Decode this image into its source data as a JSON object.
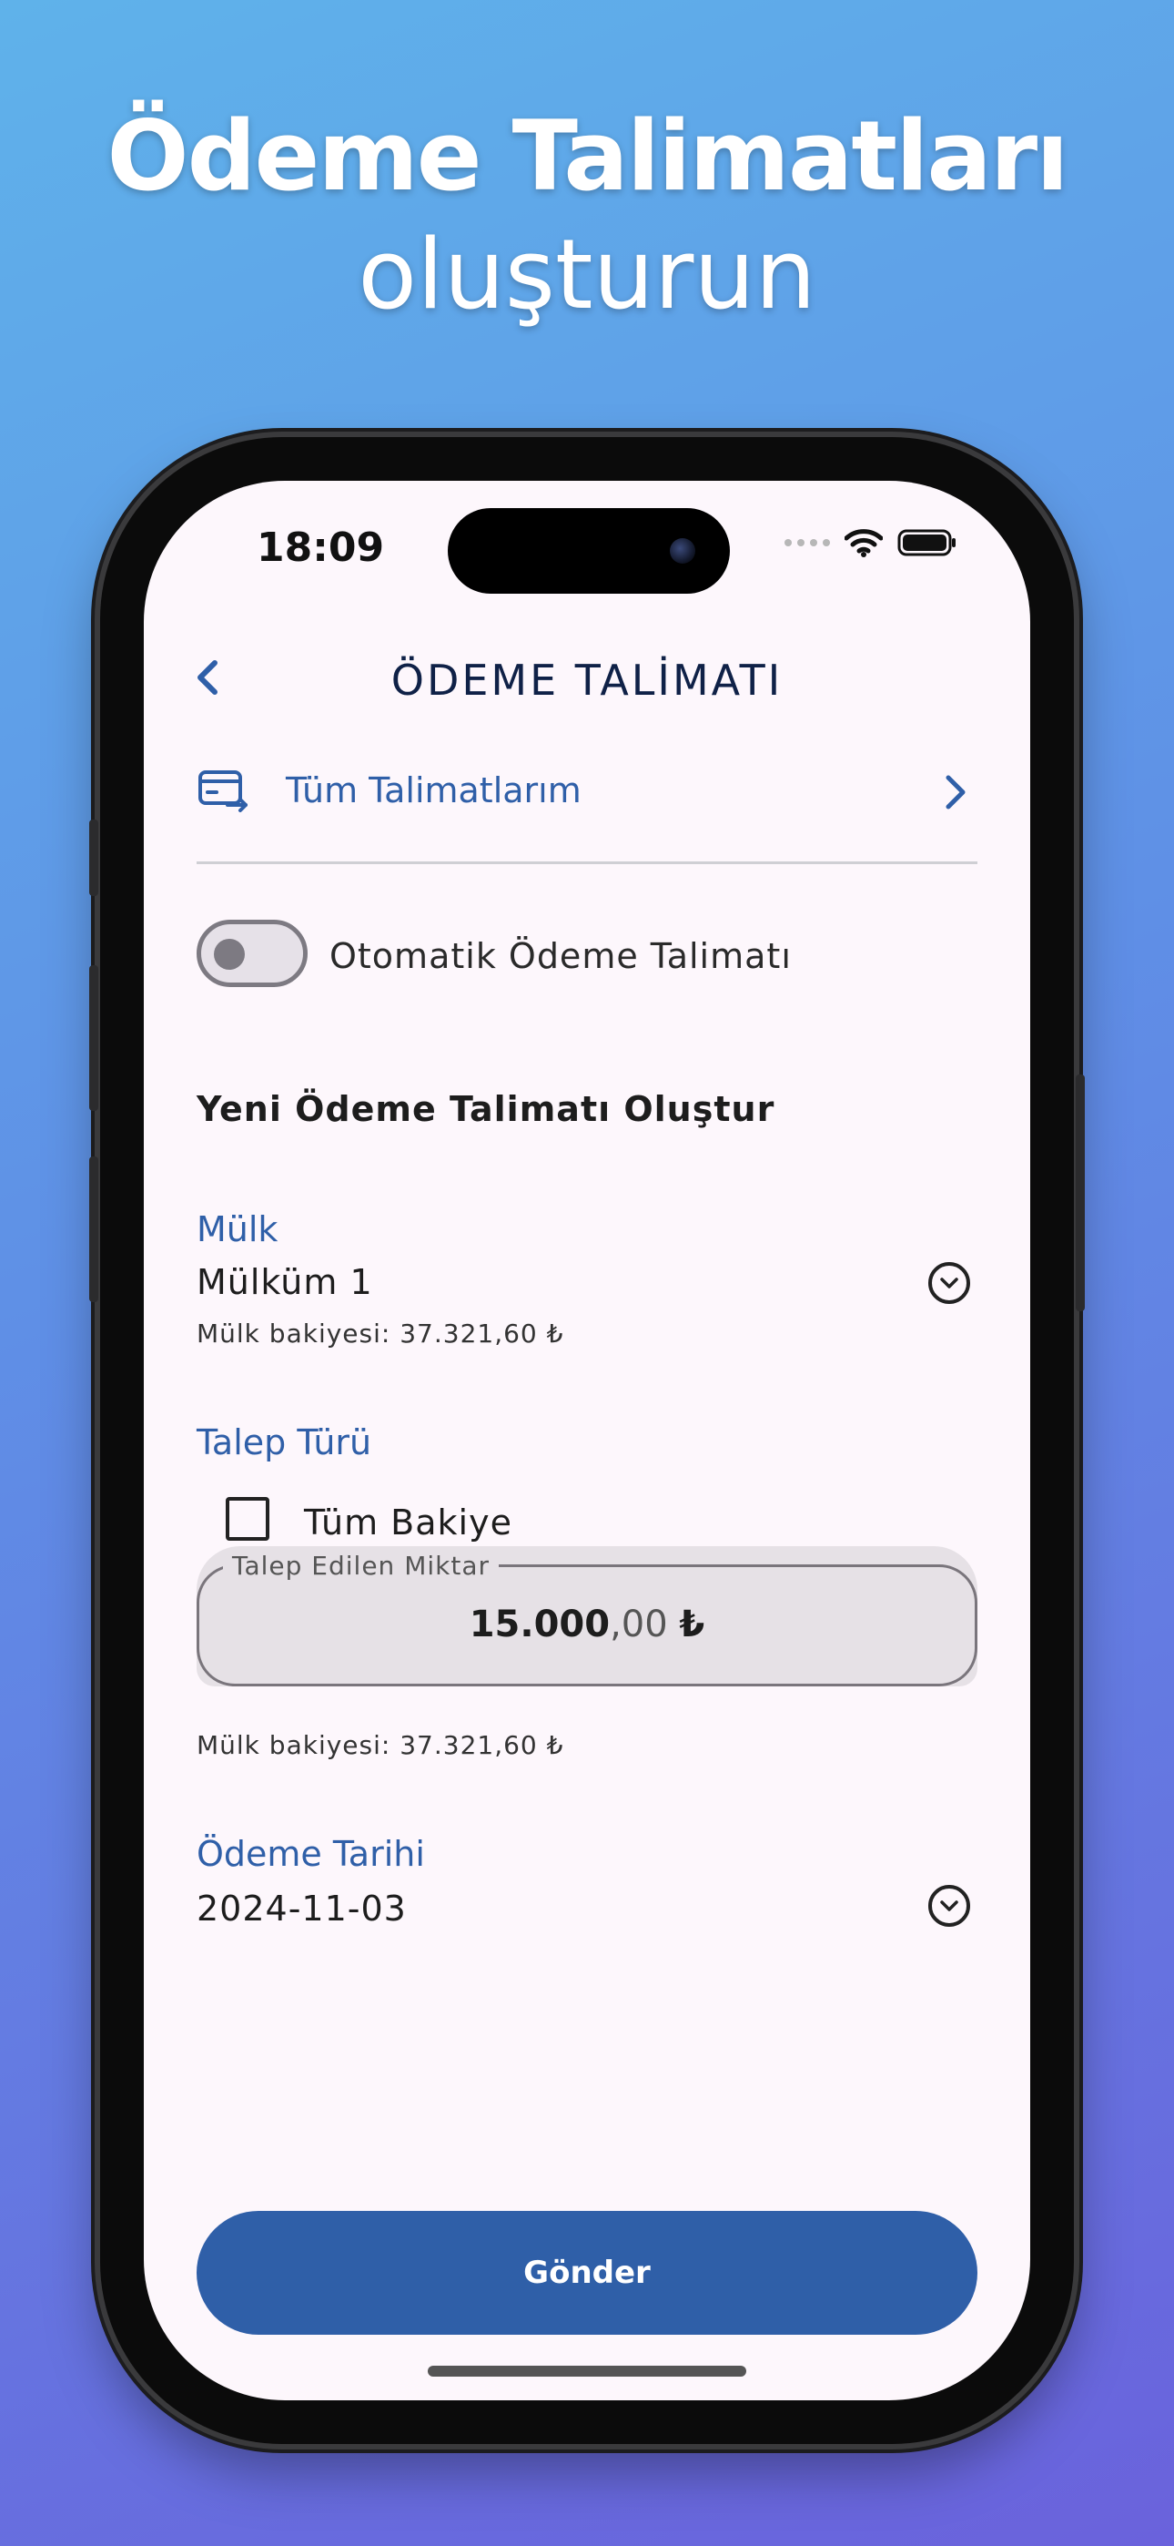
{
  "promo": {
    "line1": "Ödeme Talimatları",
    "line2": "oluşturun"
  },
  "status_bar": {
    "time": "18:09"
  },
  "header": {
    "title": "ÖDEME TALİMATI"
  },
  "all_instructions": {
    "label": "Tüm Talimatlarım"
  },
  "auto_payment": {
    "label": "Otomatik Ödeme Talimatı",
    "enabled": false
  },
  "new_section": {
    "title": "Yeni Ödeme Talimatı Oluştur"
  },
  "property": {
    "label": "Mülk",
    "value": "Mülküm 1",
    "balance_hint": "Mülk bakiyesi: 37.321,60 ₺"
  },
  "request_type": {
    "label": "Talep Türü",
    "full_balance_label": "Tüm Bakiye",
    "full_balance_checked": false
  },
  "amount": {
    "legend": "Talep Edilen Miktar",
    "integer_part": "15.000",
    "decimal_part": ",00",
    "currency": "₺",
    "balance_hint": "Mülk bakiyesi: 37.321,60 ₺"
  },
  "payment_date": {
    "label": "Ödeme Tarihi",
    "value": "2024-11-03"
  },
  "submit": {
    "label": "Gönder"
  },
  "colors": {
    "accent": "#2f5fa8",
    "title": "#0f2147",
    "screen_bg": "#fdf7fc"
  },
  "icons": [
    "back-chevron-icon",
    "card-transfer-icon",
    "chevron-right-icon",
    "chevron-down-circle-icon",
    "wifi-icon",
    "battery-icon"
  ]
}
